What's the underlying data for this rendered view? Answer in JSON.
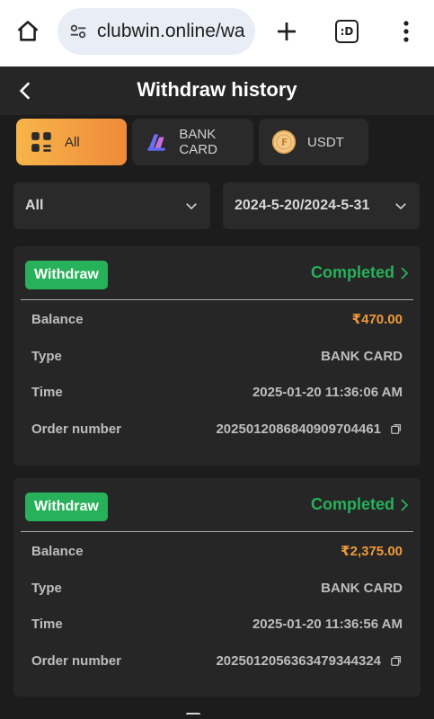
{
  "browser": {
    "url": "clubwin.online/wa",
    "tab_count_label": ":D"
  },
  "header": {
    "title": "Withdraw history"
  },
  "filter_tabs": [
    {
      "label": "All",
      "icon": "grid-icon",
      "active": true
    },
    {
      "label": "BANK CARD",
      "icon": "bank-card-icon",
      "active": false
    },
    {
      "label": "USDT",
      "icon": "usdt-coin-icon",
      "active": false
    }
  ],
  "filters": {
    "type_value": "All",
    "date_range": "2024-5-20/2024-5-31"
  },
  "records": [
    {
      "badge": "Withdraw",
      "status": "Completed",
      "balance_label": "Balance",
      "balance": "₹470.00",
      "type_label": "Type",
      "type": "BANK CARD",
      "time_label": "Time",
      "time": "2025-01-20 11:36:06 AM",
      "order_label": "Order number",
      "order": "2025012086840909704461"
    },
    {
      "badge": "Withdraw",
      "status": "Completed",
      "balance_label": "Balance",
      "balance": "₹2,375.00",
      "type_label": "Type",
      "type": "BANK CARD",
      "time_label": "Time",
      "time": "2025-01-20 11:36:56 AM",
      "order_label": "Order number",
      "order": "2025012056363479344324"
    }
  ],
  "colors": {
    "accent_orange": "#f08a3a",
    "success_green": "#27b15a",
    "background": "#1c1c1c",
    "card": "#262626"
  }
}
